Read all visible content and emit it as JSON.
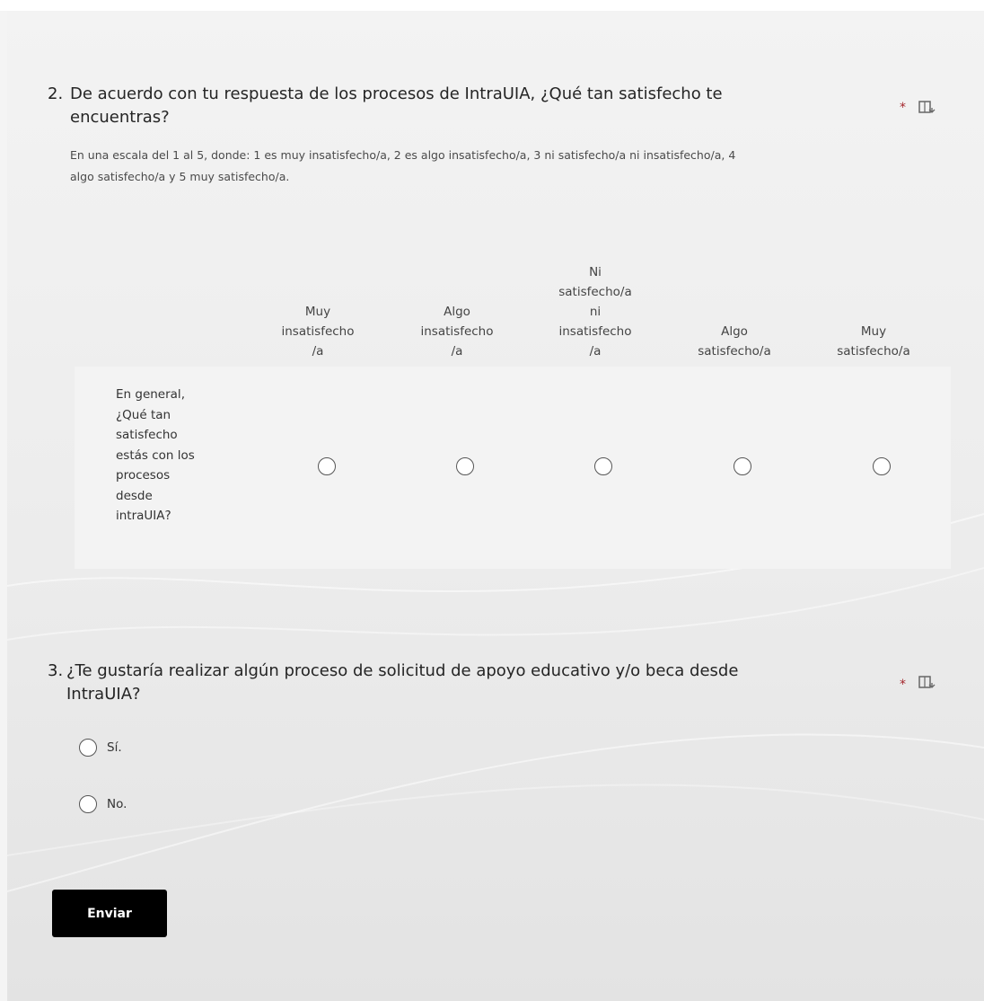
{
  "question2": {
    "number": "2.",
    "title_line1": "De acuerdo con tu respuesta de los procesos de IntraUIA, ¿Qué tan satisfecho te",
    "title_line2": "encuentras?",
    "required_mark": "*",
    "subtitle_line1": "En una escala del 1 al 5, donde: 1 es muy insatisfecho/a, 2 es algo insatisfecho/a, 3 ni satisfecho/a ni insatisfecho/a, 4",
    "subtitle_line2": "algo satisfecho/a y 5 muy satisfecho/a.",
    "columns": [
      {
        "lines": [
          "Muy",
          "insatisfecho",
          "/a"
        ]
      },
      {
        "lines": [
          "Algo",
          "insatisfecho",
          "/a"
        ]
      },
      {
        "lines": [
          "Ni",
          "satisfecho/a",
          "ni",
          "insatisfecho",
          "/a"
        ]
      },
      {
        "lines": [
          "Algo",
          "satisfecho/a"
        ]
      },
      {
        "lines": [
          "Muy",
          "satisfecho/a"
        ]
      }
    ],
    "row_label_lines": [
      "En general,",
      "¿Qué tan",
      "satisfecho",
      "estás con los",
      "procesos",
      "desde",
      "intraUIA?"
    ],
    "icon": "immersive-reader-icon"
  },
  "question3": {
    "number": "3.",
    "title_line1": "¿Te gustaría realizar algún proceso de solicitud de apoyo educativo y/o beca desde",
    "title_line2": "IntraUIA?",
    "required_mark": "*",
    "options": [
      {
        "label": "Sí."
      },
      {
        "label": "No."
      }
    ],
    "icon": "immersive-reader-icon"
  },
  "submit": {
    "label": "Enviar"
  }
}
